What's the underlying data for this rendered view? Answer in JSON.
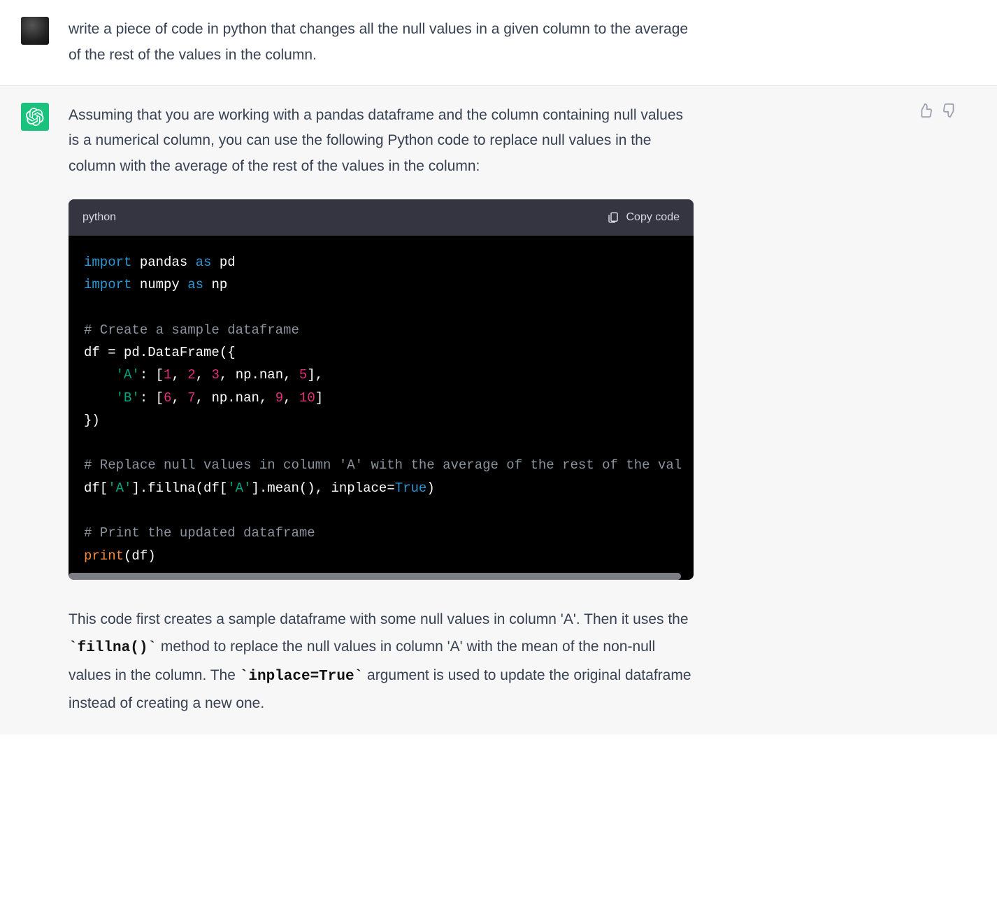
{
  "user_message": {
    "text": "write a piece of code in python that changes all the null values in a given column to the average of the rest of the values in the column."
  },
  "assistant_message": {
    "intro": "Assuming that you are working with a pandas dataframe and the column containing null values is a numerical column, you can use the following Python code to replace null values in the column with the average of the rest of the values in the column:",
    "code_lang": "python",
    "copy_label": "Copy code",
    "outro_pre": "This code first creates a sample dataframe with some null values in column 'A'. Then it uses the ",
    "inline1": "`fillna()`",
    "outro_mid": " method to replace the null values in column 'A' with the mean of the non-null values in the column. The ",
    "inline2": "`inplace=True`",
    "outro_post": " argument is used to update the original dataframe instead of creating a new one."
  },
  "code": {
    "l1_import": "import",
    "l1_mod": " pandas ",
    "l1_as": "as",
    "l1_alias": " pd",
    "l2_import": "import",
    "l2_mod": " numpy ",
    "l2_as": "as",
    "l2_alias": " np",
    "blank": "",
    "c1": "# Create a sample dataframe",
    "l4a": "df = pd.DataFrame({",
    "l5_pad": "    ",
    "l5_key": "'A'",
    "l5_colon": ": [",
    "l5_n1": "1",
    "l5_s1": ", ",
    "l5_n2": "2",
    "l5_s2": ", ",
    "l5_n3": "3",
    "l5_s3": ", np.nan, ",
    "l5_n5": "5",
    "l5_end": "],",
    "l6_pad": "    ",
    "l6_key": "'B'",
    "l6_colon": ": [",
    "l6_n1": "6",
    "l6_s1": ", ",
    "l6_n2": "7",
    "l6_s2": ", np.nan, ",
    "l6_n4": "9",
    "l6_s4": ", ",
    "l6_n5": "10",
    "l6_end": "]",
    "l7": "})",
    "c2": "# Replace null values in column 'A' with the average of the rest of the val",
    "l9a": "df[",
    "l9_key1": "'A'",
    "l9b": "].fillna(df[",
    "l9_key2": "'A'",
    "l9c": "].mean(), inplace=",
    "l9_true": "True",
    "l9d": ")",
    "c3": "# Print the updated dataframe",
    "l11_fn": "print",
    "l11_rest": "(df)"
  }
}
